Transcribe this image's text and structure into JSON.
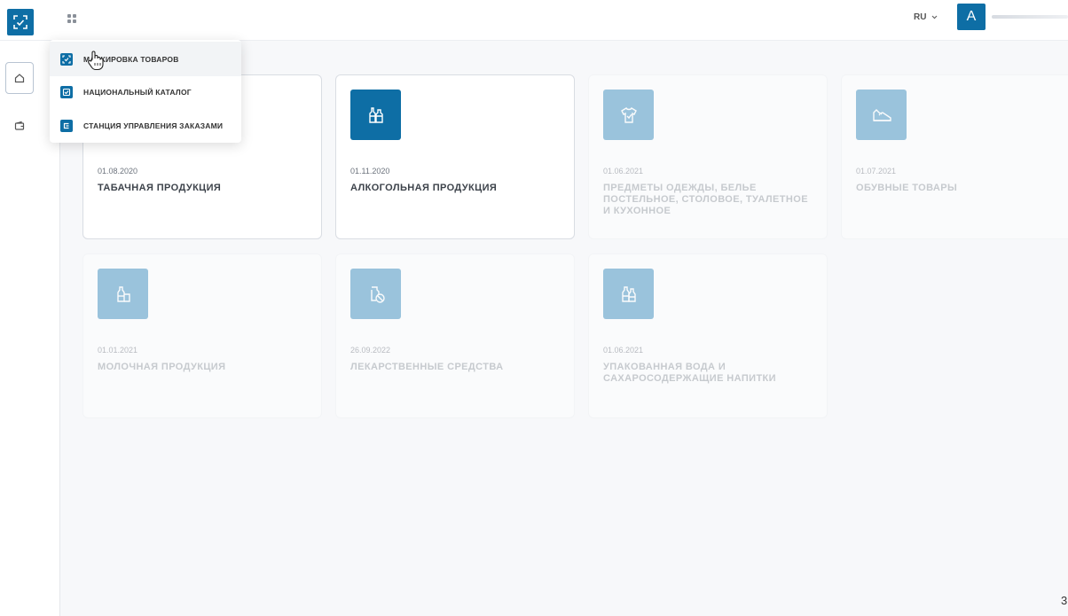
{
  "header": {
    "lang": "RU",
    "avatar_letter": "A"
  },
  "menu": {
    "items": [
      {
        "label": "маркировка товаров",
        "icon": "scan-check-icon"
      },
      {
        "label": "национальный каталог",
        "icon": "catalog-check-icon"
      },
      {
        "label": "станция управления заказами",
        "icon": "order-station-icon"
      }
    ]
  },
  "cards": [
    {
      "date": "01.08.2020",
      "title": "ТАБАЧНАЯ ПРОДУКЦИЯ",
      "icon": "tobacco-icon"
    },
    {
      "date": "01.11.2020",
      "title": "АЛКОГОЛЬНАЯ ПРОДУКЦИЯ",
      "icon": "bottles-icon"
    },
    {
      "date": "01.06.2021",
      "title": "ПРЕДМЕТЫ ОДЕЖДЫ, БЕЛЬЕ ПОСТЕЛЬНОЕ, СТОЛОВОЕ, ТУАЛЕТНОЕ И КУХОННОЕ",
      "icon": "shirt-icon"
    },
    {
      "date": "01.07.2021",
      "title": "ОБУВНЫЕ ТОВАРЫ",
      "icon": "shoe-icon"
    },
    {
      "date": "01.01.2021",
      "title": "МОЛОЧНАЯ ПРОДУКЦИЯ",
      "icon": "milk-icon"
    },
    {
      "date": "26.09.2022",
      "title": "ЛЕКАРСТВЕННЫЕ СРЕДСТВА",
      "icon": "medicine-icon"
    },
    {
      "date": "01.06.2021",
      "title": "УПАКОВАННАЯ ВОДА И САХАРОСОДЕРЖАЩИЕ НАПИТКИ",
      "icon": "water-bottles-icon"
    }
  ],
  "colors": {
    "brand": "#0e6ea5",
    "icon_faded": "#7fb0cc"
  },
  "corner_glyph": "3"
}
